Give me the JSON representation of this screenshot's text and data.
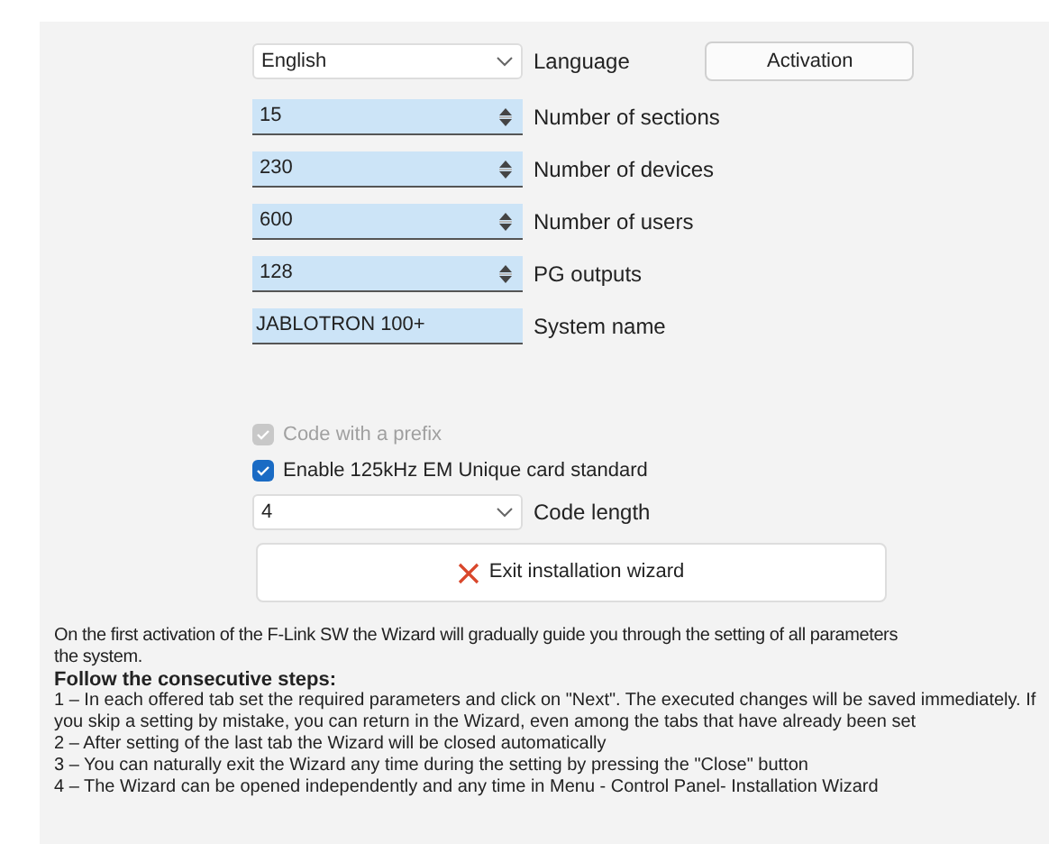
{
  "language": {
    "value": "English",
    "label": "Language"
  },
  "activation_button": "Activation",
  "spinners": [
    {
      "value": "15",
      "label": "Number of sections"
    },
    {
      "value": "230",
      "label": "Number of devices"
    },
    {
      "value": "600",
      "label": "Number of users"
    },
    {
      "value": "128",
      "label": "PG outputs"
    }
  ],
  "system_name": {
    "value": "JABLOTRON 100+",
    "label": "System name"
  },
  "checkboxes": [
    {
      "label": "Code with a prefix",
      "checked": true,
      "disabled": true
    },
    {
      "label": "Enable 125kHz EM Unique card standard",
      "checked": true,
      "disabled": false
    }
  ],
  "code_length": {
    "value": "4",
    "label": "Code length"
  },
  "exit_button": "Exit installation wizard",
  "help": {
    "intro_lines": [
      "On the first activation of the F-Link SW the Wizard will gradually guide you through the setting of all parameters",
      "the system."
    ],
    "heading": "Follow the consecutive steps:",
    "steps": [
      "1 – In each offered tab set the required parameters and click on \"Next\". The executed changes will be saved immediately. If you skip a setting by mistake, you can return in the Wizard, even among the tabs that have already been set",
      "2 – After setting of the last tab the Wizard will be closed automatically",
      "3 – You can naturally exit the Wizard any time during the setting by pressing the \"Close\" button",
      "4 – The Wizard can be opened independently and any time in Menu - Control Panel- Installation Wizard"
    ]
  }
}
